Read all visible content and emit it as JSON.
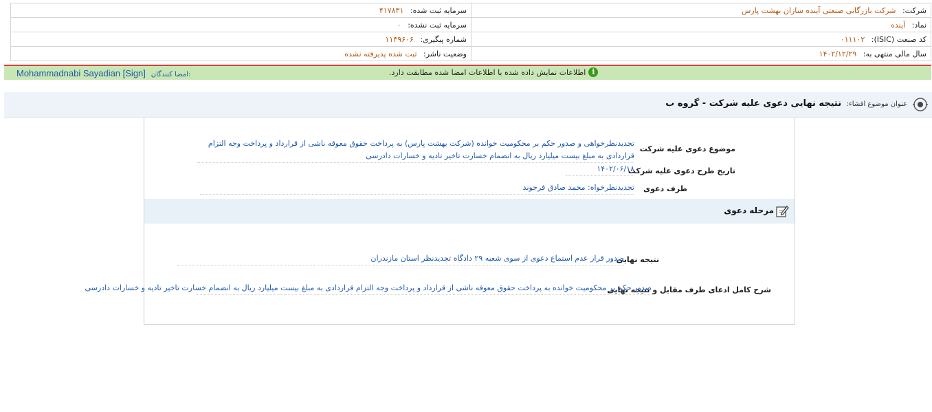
{
  "company_info": {
    "company_label": "شرکت:",
    "company_value": "شرکت بازرگانی صنعتی آینده سازان بهشت پارس",
    "symbol_label": "نماد:",
    "symbol_value": "آینده",
    "isic_label": "کد صنعت (ISIC):",
    "isic_value": "۰۱۱۱۰۲",
    "fiscal_year_label": "سال مالی منتهی به:",
    "fiscal_year_value": "۱۴۰۲/۱۲/۲۹",
    "registered_capital_label": "سرمایه ثبت شده:",
    "registered_capital_value": "۴۱۷۸۳۱",
    "unregistered_capital_label": "سرمایه ثبت نشده:",
    "unregistered_capital_value": "۰",
    "tracking_number_label": "شماره پیگیری:",
    "tracking_number_value": "۱۱۳۹۶۰۶",
    "publisher_status_label": "وضعیت ناشر:",
    "publisher_status_value": "ثبت شده پذیرفته نشده"
  },
  "notice": {
    "message": "اطلاعات نمایش داده شده با اطلاعات امضا شده مطابقت دارد.",
    "info_icon": "i",
    "signers_label": "امضا کنندگان:",
    "signers_value": "Mohammadnabi Sayadian [Sign]"
  },
  "title_bar": {
    "label": "عنوان موضوع افشاء:",
    "title": "نتیجه نهایی دعوی علیه شرکت - گروه ب"
  },
  "lawsuit": {
    "subject_label": "موضوع دعوی علیه شرکت",
    "subject_value": "تجدیدنظرخواهی و صدور حکم بر محکومیت خوانده (شرکت بهشت پارس) به پرداخت حقوق معوقه ناشی از قرارداد و پرداخت وجه التزام قراردادی به مبلغ بیست میلیارد ریال به انضمام خسارت تاخیر تادیه و خسارات دادرسی",
    "date_label": "تاریخ طرح دعوی علیه شرکت",
    "date_value": "۱۴۰۲/۰۶/۱۸",
    "party_label": "طرف دعوی",
    "party_value": "تجدیدنظرخواه: محمد صادق فرجوند"
  },
  "stage": {
    "title": "مرحله دعوی",
    "result_label": "نتیجه نهایی",
    "result_value": "صدور قرار عدم استماع دعوی از سوی شعبه ۲۹ دادگاه تجدیدنظر استان مازندران",
    "description_label": "شرح کامل ادعای طرف مقابل و نتیجه نهایی",
    "description_value": "صدور حکم بر محکومیت خوانده به پرداخت حقوق معوقه ناشی از قرارداد و پرداخت وجه التزام قراردادی به مبلغ بیست میلیارد ریال به انضمام خسارت تاخیر تادیه و خسارات دادرسی"
  },
  "colors": {
    "value_text": "#b55a14",
    "link_blue": "#1f5aa8",
    "notice_bg": "#c9e6b5",
    "notice_border": "#e53935",
    "title_bg": "#eef3fa"
  }
}
